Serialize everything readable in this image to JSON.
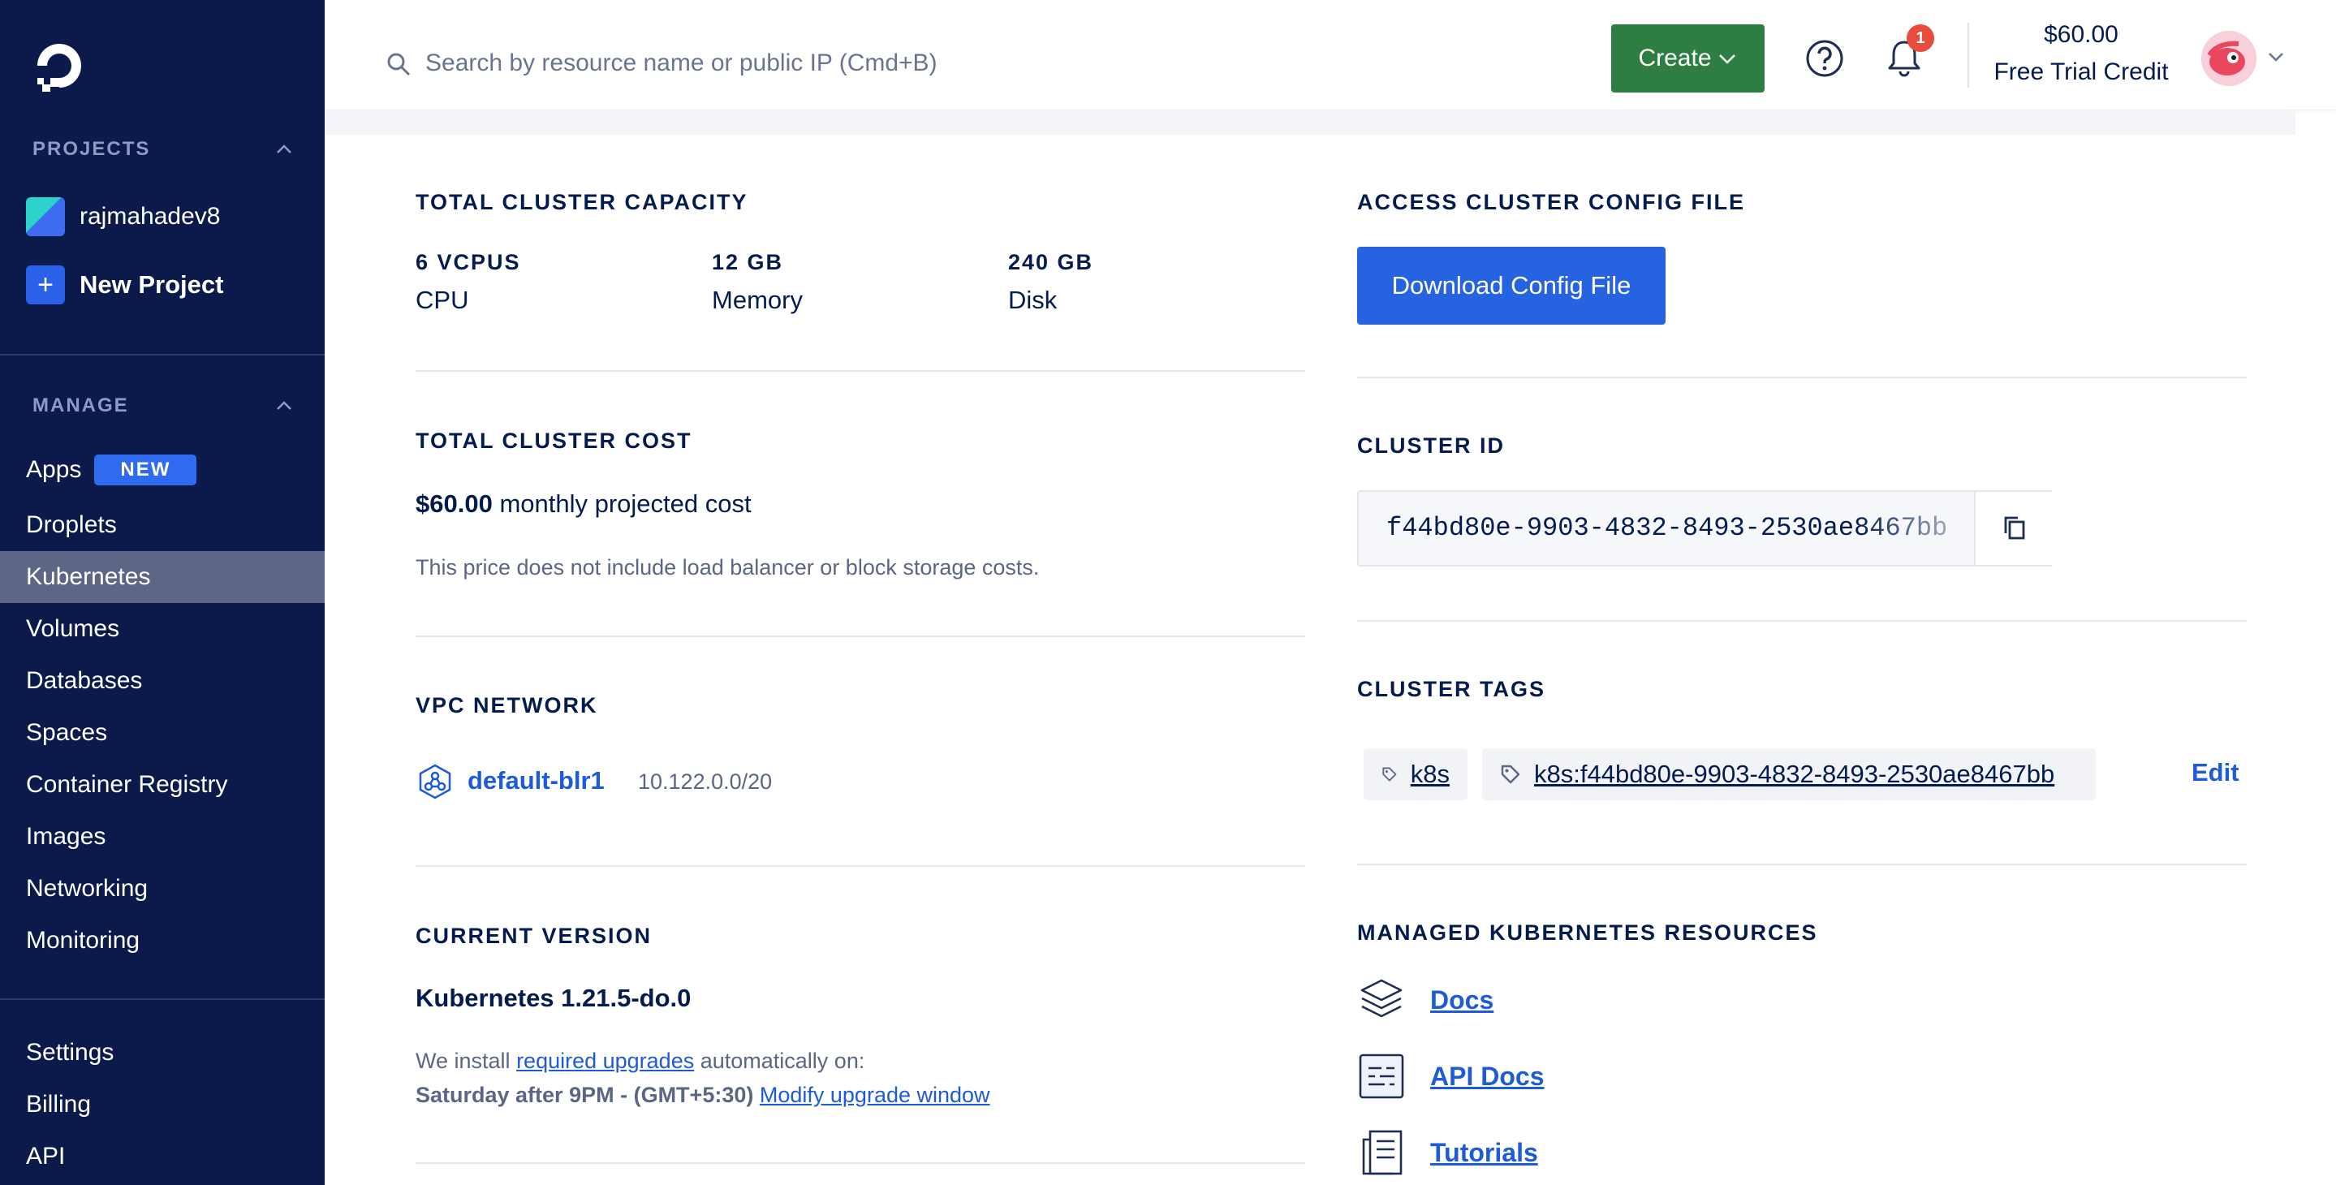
{
  "sidebar": {
    "projects_title": "PROJECTS",
    "projects": [
      {
        "label": "rajmahadev8"
      }
    ],
    "new_project_label": "New Project",
    "manage_title": "MANAGE",
    "nav": [
      {
        "label": "Apps",
        "badge": "NEW"
      },
      {
        "label": "Droplets"
      },
      {
        "label": "Kubernetes",
        "active": true
      },
      {
        "label": "Volumes"
      },
      {
        "label": "Databases"
      },
      {
        "label": "Spaces"
      },
      {
        "label": "Container Registry"
      },
      {
        "label": "Images"
      },
      {
        "label": "Networking"
      },
      {
        "label": "Monitoring"
      }
    ],
    "bottom_nav": [
      {
        "label": "Settings"
      },
      {
        "label": "Billing"
      },
      {
        "label": "API"
      }
    ]
  },
  "header": {
    "search_placeholder": "Search by resource name or public IP (Cmd+B)",
    "create_label": "Create",
    "notification_count": "1",
    "credit_amount": "$60.00",
    "credit_label": "Free Trial Credit"
  },
  "capacity": {
    "title": "TOTAL CLUSTER CAPACITY",
    "stats": [
      {
        "value": "6 VCPUS",
        "label": "CPU"
      },
      {
        "value": "12 GB",
        "label": "Memory"
      },
      {
        "value": "240 GB",
        "label": "Disk"
      }
    ]
  },
  "cost": {
    "title": "TOTAL CLUSTER COST",
    "amount": "$60.00",
    "amount_suffix": "monthly projected cost",
    "note": "This price does not include load balancer or block storage costs."
  },
  "vpc": {
    "title": "VPC NETWORK",
    "name": "default-blr1",
    "cidr": "10.122.0.0/20"
  },
  "version": {
    "title": "CURRENT VERSION",
    "value": "Kubernetes 1.21.5-do.0",
    "install_prefix": "We install",
    "install_link": "required upgrades",
    "install_suffix": "automatically on:",
    "window": "Saturday after 9PM - (GMT+5:30)",
    "modify_link": "Modify upgrade window"
  },
  "config": {
    "title": "ACCESS CLUSTER CONFIG FILE",
    "button_label": "Download Config File"
  },
  "cluster_id": {
    "title": "CLUSTER ID",
    "value": "f44bd80e-9903-4832-8493-2530ae8467bb"
  },
  "tags": {
    "title": "CLUSTER TAGS",
    "items": [
      "k8s",
      "k8s:f44bd80e-9903-4832-8493-2530ae8467bb"
    ],
    "edit_label": "Edit"
  },
  "resources": {
    "title": "MANAGED KUBERNETES RESOURCES",
    "items": [
      {
        "label": "Docs",
        "icon": "layers-icon"
      },
      {
        "label": "API Docs",
        "icon": "api-doc-icon"
      },
      {
        "label": "Tutorials",
        "icon": "tutorial-icon"
      }
    ]
  },
  "colors": {
    "sidebar_bg": "#0b1a4a",
    "active_nav_bg": "#5d6785",
    "create_green": "#2e7d43",
    "primary_blue": "#2563e0",
    "link_blue": "#1e5bd8",
    "badge_red": "#e74c3c"
  }
}
